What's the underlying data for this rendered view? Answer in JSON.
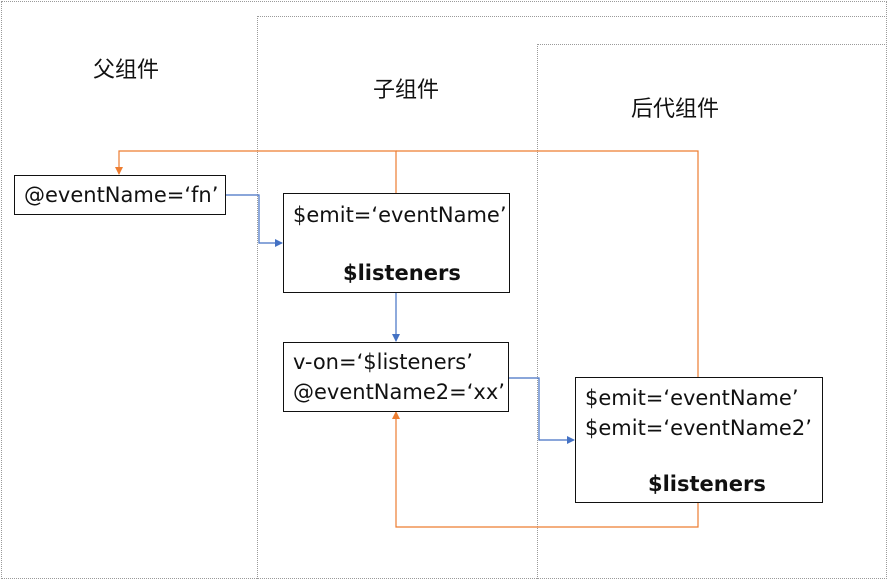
{
  "regions": {
    "parent_title": "父组件",
    "child_title": "子组件",
    "descendant_title": "后代组件"
  },
  "boxes": {
    "parent_box": {
      "line1": "@eventName=‘fn’"
    },
    "child_box": {
      "line1": "$emit=‘eventName’",
      "line2": "$listeners"
    },
    "von_box": {
      "line1": "v-on=‘$listeners’",
      "line2": "@eventName2=‘xx’"
    },
    "descendant_box": {
      "line1": "$emit=‘eventName’",
      "line2": "$emit=‘eventName2’",
      "line3": "$listeners"
    }
  },
  "colors": {
    "blue_arrow": "#4472c4",
    "orange_arrow": "#ed7d31",
    "region_border": "#9a9a9a"
  }
}
